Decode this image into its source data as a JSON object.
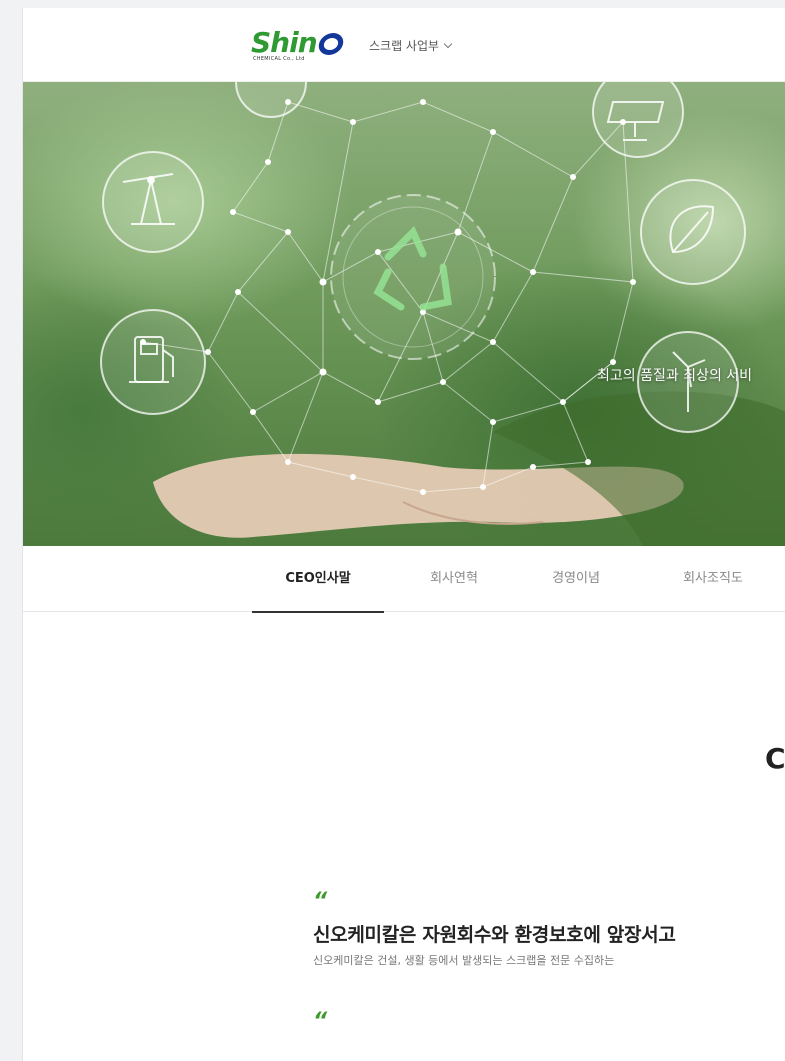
{
  "header": {
    "logo_text": "Shin",
    "logo_sub": "CHEMICAL Co., Ltd",
    "business_menu_label": "스크랩 사업부"
  },
  "hero": {
    "caption": "최고의 품질과 최상의 서비"
  },
  "tabs": [
    {
      "label": "CEO인사말",
      "active": true
    },
    {
      "label": "회사연혁",
      "active": false
    },
    {
      "label": "경영이념",
      "active": false
    },
    {
      "label": "회사조직도",
      "active": false
    }
  ],
  "content": {
    "section_title_fragment": "C",
    "quote_mark": "“",
    "statement": "신오케미칼은 자원회수와 환경보호에 앞장서고",
    "description": "신오케미칼은 건설, 생활 등에서 발생되는 스크랩을 전문 수집하는",
    "quote_mark_2": "“"
  },
  "colors": {
    "brand_green": "#2f9a31",
    "brand_blue": "#13389a",
    "quote_green": "#3f9a2e"
  }
}
